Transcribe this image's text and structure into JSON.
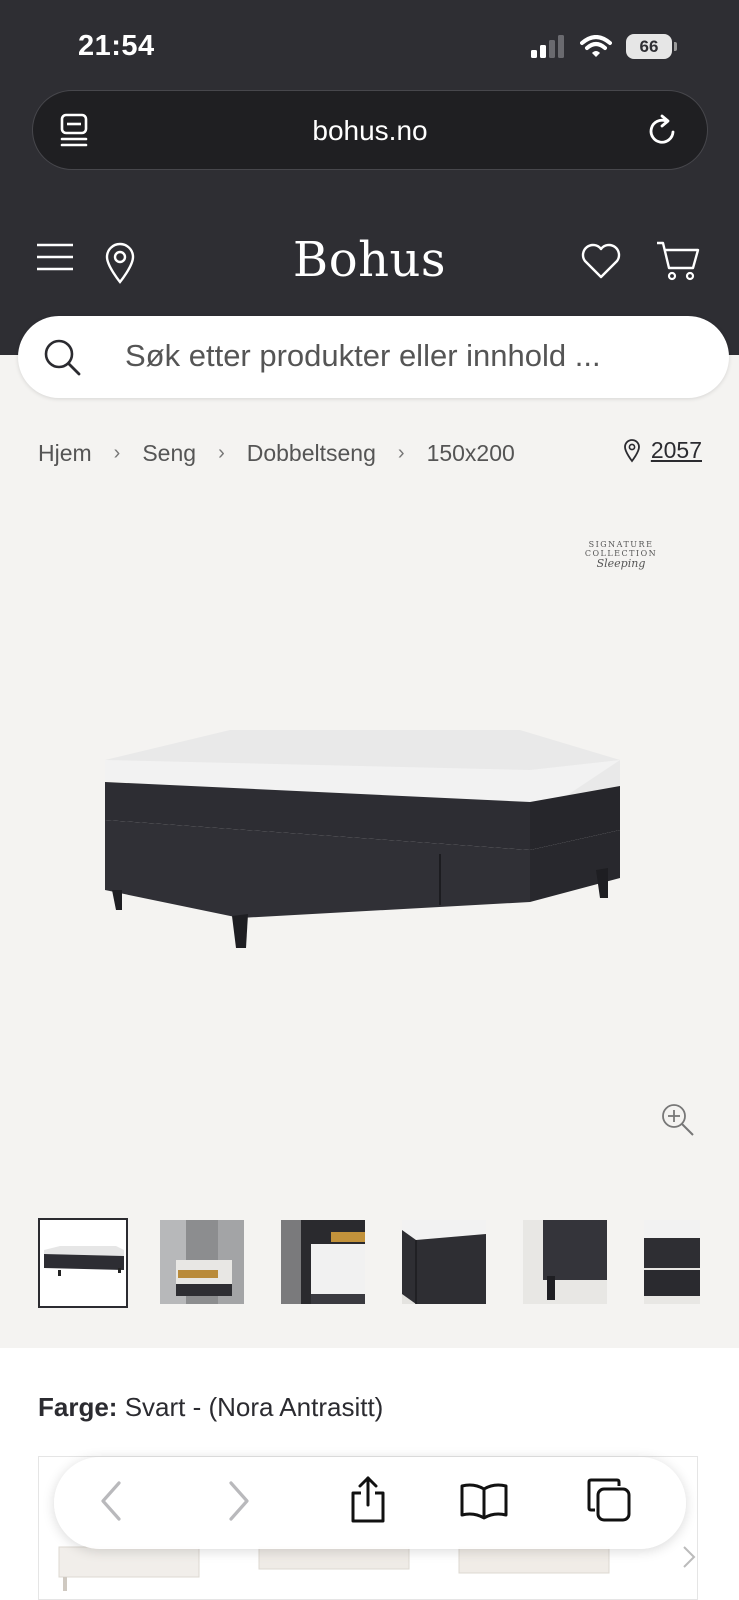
{
  "status": {
    "time": "21:54",
    "battery": "66"
  },
  "browser": {
    "url": "bohus.no"
  },
  "header": {
    "logo": "Bohus"
  },
  "search": {
    "placeholder": "Søk etter produkter eller innhold ..."
  },
  "breadcrumb": {
    "items": [
      "Hjem",
      "Seng",
      "Dobbeltseng",
      "150x200"
    ],
    "separator": "›"
  },
  "store": {
    "number": "2057"
  },
  "badge": {
    "line1": "SIGNATURE COLLECTION",
    "line2": "Sleeping"
  },
  "gallery": {
    "thumbnail_count": 6,
    "active_index": 0
  },
  "product": {
    "color_label": "Farge:",
    "color_value": "Svart - (Nora Antrasitt)"
  },
  "icons": {
    "tabs": "tabs-icon",
    "reload": "reload-icon",
    "menu": "menu-icon",
    "location": "location-pin-icon",
    "heart": "heart-icon",
    "cart": "cart-icon",
    "search": "search-icon",
    "zoom": "zoom-in-icon",
    "back": "back-arrow-icon",
    "forward": "forward-arrow-icon",
    "share": "share-icon",
    "bookmarks": "bookmarks-icon",
    "tab_overview": "tab-overview-icon"
  },
  "colors": {
    "header_bg": "#2e2e33",
    "page_bg": "#f4f3f1",
    "text": "#2b2b30"
  }
}
